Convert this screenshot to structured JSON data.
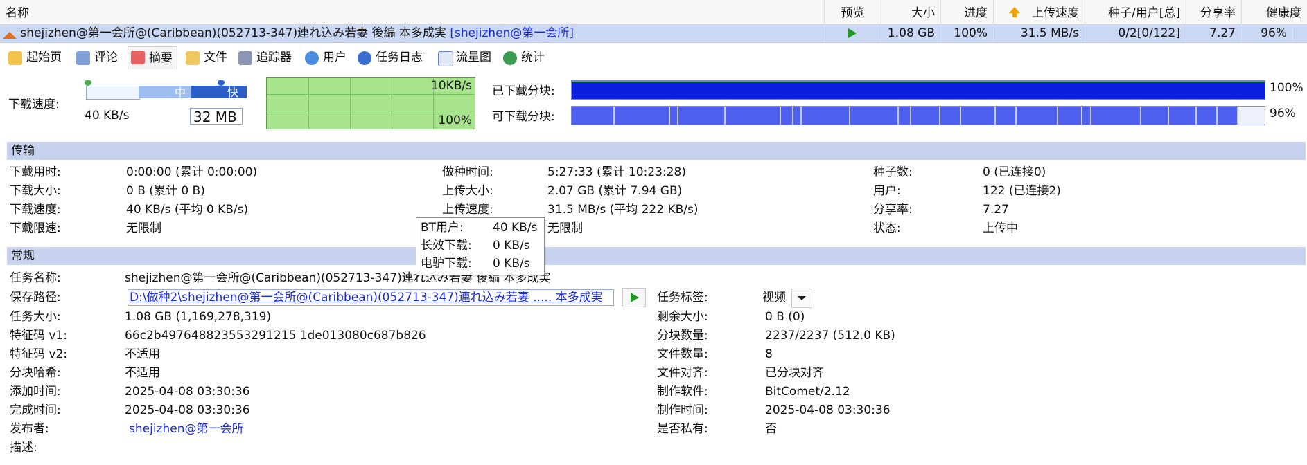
{
  "header": {
    "name": "名称",
    "preview": "预览",
    "size": "大小",
    "progress": "进度",
    "upload_speed": "上传速度",
    "seeds_users": "种子/用户[总]",
    "ratio": "分享率",
    "health": "健康度"
  },
  "task": {
    "name": "shejizhen@第一会所@(Caribbean)(052713-347)連れ込み若妻 後編 本多成実",
    "tag": "[shejizhen@第一会所]",
    "size": "1.08 GB",
    "progress": "100%",
    "upload_speed": "31.5 MB/s",
    "seeds_users": "0/2[0/122]",
    "ratio": "7.27",
    "health": "96%"
  },
  "tabs": [
    "起始页",
    "评论",
    "摘要",
    "文件",
    "追踪器",
    "用户",
    "任务日志",
    "流量图",
    "统计"
  ],
  "speed": {
    "label": "下载速度:",
    "mid_label": "中",
    "fast_label": "快",
    "current": "40 KB/s",
    "cache": "32 MB",
    "graph_top": "10KB/s",
    "graph_bottom": "100%"
  },
  "blocks": {
    "downloaded_label": "已下载分块:",
    "downloaded_pct": "100%",
    "downloaded_fill": 1.0,
    "available_label": "可下载分块:",
    "available_pct": "96%",
    "available_fill": 0.96
  },
  "transfer": {
    "title": "传输",
    "col1": [
      {
        "label": "下载用时:",
        "value": "0:00:00 (累计 0:00:00)"
      },
      {
        "label": "下载大小:",
        "value": "0 B (累计 0 B)"
      },
      {
        "label": "下载速度:",
        "value": "40 KB/s (平均 0 KB/s)"
      },
      {
        "label": "下载限速:",
        "value": "无限制"
      }
    ],
    "col2": [
      {
        "label": "做种时间:",
        "value": "5:27:33 (累计 10:23:28)"
      },
      {
        "label": "上传大小:",
        "value": "2.07 GB (累计 7.94 GB)"
      },
      {
        "label": "上传速度:",
        "value": "31.5 MB/s (平均 222 KB/s)"
      },
      {
        "label": "",
        "value": "无限制"
      }
    ],
    "col3": [
      {
        "label": "种子数:",
        "value": "0 (已连接0)"
      },
      {
        "label": "用户:",
        "value": "122 (已连接2)"
      },
      {
        "label": "分享率:",
        "value": "7.27"
      },
      {
        "label": "状态:",
        "value": "上传中"
      }
    ]
  },
  "tooltip": [
    {
      "label": "BT用户:",
      "value": "40 KB/s"
    },
    {
      "label": "长效下载:",
      "value": "0 KB/s"
    },
    {
      "label": "电驴下载:",
      "value": "0 KB/s"
    }
  ],
  "general": {
    "title": "常规",
    "task_name_label": "任务名称:",
    "task_name": "shejizhen@第一会所@(Caribbean)(052713-347)連れ込み若妻 後編 本多成実",
    "save_path_label": "保存路径:",
    "save_path": "D:\\做种2\\shejizhen@第一会所@(Caribbean)(052713-347)連れ込み若妻 ..... 本多成実",
    "task_tag_label": "任务标签:",
    "task_tag": "视频",
    "left": [
      {
        "label": "任务大小:",
        "value": "1.08 GB (1,169,278,319)"
      },
      {
        "label": "特征码 v1:",
        "value": "66c2b497648823553291215 1de013080c687b826"
      },
      {
        "label": "特征码 v2:",
        "value": "不适用"
      },
      {
        "label": "分块哈希:",
        "value": "不适用"
      },
      {
        "label": "添加时间:",
        "value": "2025-04-08 03:30:36"
      },
      {
        "label": "完成时间:",
        "value": "2025-04-08 03:30:36"
      },
      {
        "label": "发布者:",
        "value": "shejizhen@第一会所"
      },
      {
        "label": "描述:",
        "value": ""
      }
    ],
    "right": [
      {
        "label": "剩余大小:",
        "value": "0 B (0)"
      },
      {
        "label": "分块数量:",
        "value": "2237/2237 (512.0 KB)"
      },
      {
        "label": "文件数量:",
        "value": "8"
      },
      {
        "label": "文件对齐:",
        "value": "已分块对齐"
      },
      {
        "label": "制作软件:",
        "value": "BitComet/2.12"
      },
      {
        "label": "制作时间:",
        "value": "2025-04-08 03:30:36"
      },
      {
        "label": "是否私有:",
        "value": "否"
      }
    ]
  },
  "colors": {
    "accent": "#1a2bd6",
    "header_bg": "#c8d4ef",
    "row_sel": "#cad8f4",
    "graph_green": "#a6e38b"
  }
}
